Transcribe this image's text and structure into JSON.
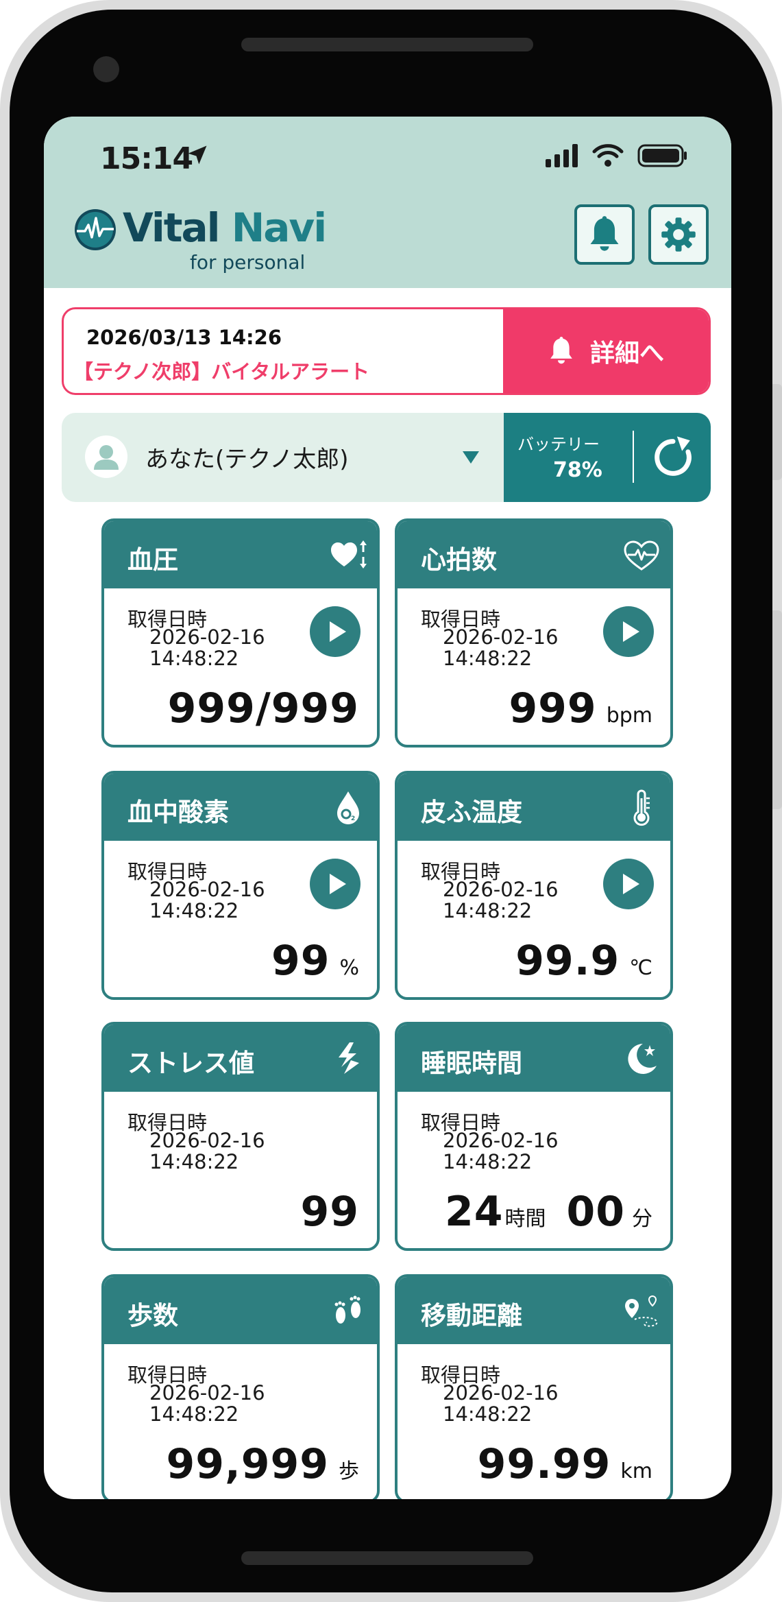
{
  "status_bar": {
    "time": "15:14"
  },
  "app": {
    "name_part1": "Vital",
    "name_part2": "Navi",
    "subtitle": "for personal"
  },
  "alert": {
    "datetime": "2026/03/13 14:26",
    "message": "【テクノ次郎】バイタルアラート",
    "button_label": "詳細へ"
  },
  "user": {
    "name": "あなた(テクノ太郎)"
  },
  "battery": {
    "label": "バッテリー",
    "value": "78%"
  },
  "timestamp_label": "取得日時",
  "cards": [
    {
      "title": "血圧",
      "icon": "heart-arrows-icon",
      "date": "2026-02-16",
      "time": "14:48:22",
      "value": "999/999",
      "unit": ""
    },
    {
      "title": "心拍数",
      "icon": "heart-pulse-icon",
      "date": "2026-02-16",
      "time": "14:48:22",
      "value": "999",
      "unit": "bpm"
    },
    {
      "title": "血中酸素",
      "icon": "oxygen-drop-icon",
      "date": "2026-02-16",
      "time": "14:48:22",
      "value": "99",
      "unit": "%"
    },
    {
      "title": "皮ふ温度",
      "icon": "thermometer-icon",
      "date": "2026-02-16",
      "time": "14:48:22",
      "value": "99.9",
      "unit": "℃"
    },
    {
      "title": "ストレス値",
      "icon": "lightning-icon",
      "date": "2026-02-16",
      "time": "14:48:22",
      "value": "99",
      "unit": ""
    },
    {
      "title": "睡眠時間",
      "icon": "moon-star-icon",
      "date": "2026-02-16",
      "time": "14:48:22",
      "hours": "24",
      "hours_unit": "時間",
      "minutes": "00",
      "minutes_unit": "分"
    },
    {
      "title": "歩数",
      "icon": "footprints-icon",
      "date": "2026-02-16",
      "time": "14:48:22",
      "value": "99,999",
      "unit": "歩"
    },
    {
      "title": "移動距離",
      "icon": "map-route-icon",
      "date": "2026-02-16",
      "time": "14:48:22",
      "value": "99.99",
      "unit": "km"
    }
  ],
  "colors": {
    "teal": "#2e7f80",
    "header_bg": "#bcdcd4",
    "alert": "#f03a69",
    "battery_bg": "#1c7f82"
  }
}
